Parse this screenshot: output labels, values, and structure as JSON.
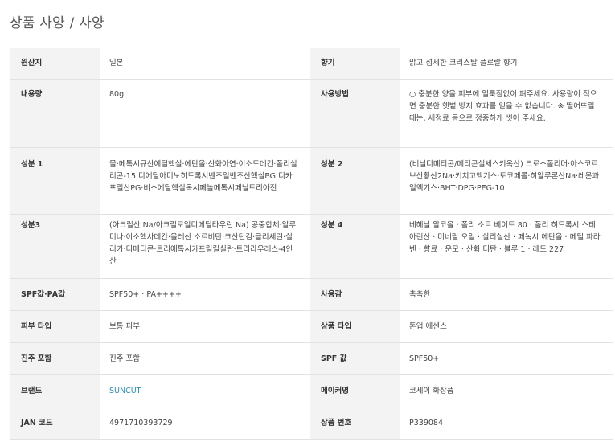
{
  "page": {
    "title": "상품 사양 / 사양"
  },
  "colors": {
    "label_background": "#f3f3f3",
    "border": "#e2e2e2",
    "link": "#2a8fb3"
  },
  "spec": {
    "rows": [
      {
        "label_left": "원산지",
        "value_left": "일본",
        "label_right": "향기",
        "value_right": "맑고 섬세한 크리스탈 플로랄 향기"
      },
      {
        "label_left": "내용량",
        "value_left": "80g",
        "label_right": "사용방법",
        "value_right": "○ 충분한 양을 피부에 얼룩짐없이 펴주세요. 사용량이 적으면 충분한 햇볕 방지 효과를 얻을 수 없습니다. ※ 떨어뜨릴 때는, 세정료 등으로 정중하게 씻어 주세요."
      },
      {
        "label_left": "성분 1",
        "value_left": "물·메톡시규산에틸헥실·에탄올·산화아연·이소도데칸·폴리실리콘-15·디에틸아미노히드록시벤조일벤조산헥실BG·디카프릴산PG·비스에틸헥실옥시페놀메톡시페닐트리아진",
        "label_right": "성분 2",
        "value_right": "(비닐디메티콘/메티콘실세스키옥산) 크로스폴리머·아스코르브산황산2Na·키치고엑기스·토코페롤·히알루론산Na·레몬과일엑기스·BHT·DPG·PEG-10"
      },
      {
        "label_left": "성분3",
        "value_left": "(아크릴산 Na/아크릴로일디메틸타우린 Na) 공중합체·알루미나·이소헥사데칸·올레산 소르비탄·크산탄검·글리세린·실리카·디메티콘·트리에톡시카프릴릴실란·트리라우레스-4인산",
        "label_right": "성분 4",
        "value_right": "베헤닐 알코올 · 폴리 소르 베이트 80 · 폴리 히드록시 스테아린산 · 미네랄 오일 · 살리실산 · 페녹시 에탄올 · 메틸 파라벤 · 향료 · 운모 · 산화 티탄 · 블루 1 · 레드 227"
      },
      {
        "label_left": "SPF값·PA값",
        "value_left": "SPF50+ · PA++++",
        "label_right": "사용감",
        "value_right": "촉촉한"
      },
      {
        "label_left": "피부 타입",
        "value_left": "보통 피부",
        "label_right": "상품 타입",
        "value_right": "톤업 에센스"
      },
      {
        "label_left": "진주 포함",
        "value_left": "진주 포함",
        "label_right": "SPF 값",
        "value_right": "SPF50+"
      },
      {
        "label_left": "브랜드",
        "value_left": "SUNCUT",
        "label_right": "메이커명",
        "value_right": "코세이 화장품"
      },
      {
        "label_left": "JAN 코드",
        "value_left": "4971710393729",
        "label_right": "상품 번호",
        "value_right": "P339084"
      }
    ]
  }
}
